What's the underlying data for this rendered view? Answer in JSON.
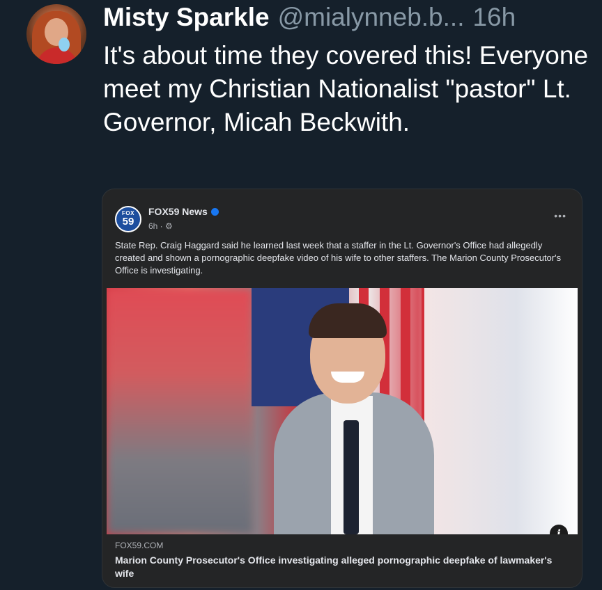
{
  "tweet": {
    "display_name": "Misty Sparkle",
    "handle": "@mialynneb.b...",
    "time": "16h",
    "text": "It's about time they covered this! Everyone meet my Christian Nationalist \"pastor\" Lt. Governor, Micah Beckwith."
  },
  "embed": {
    "page_name": "FOX59 News",
    "logo_top": "FOX",
    "logo_num": "59",
    "post_time": "6h · ⚙",
    "more": "•••",
    "post_text": "State Rep. Craig Haggard said he learned last week that a staffer in the Lt. Governor's Office had allegedly created and shown a pornographic deepfake video of his wife to other staffers. The Marion County Prosecutor's Office is investigating.",
    "link_domain": "FOX59.COM",
    "link_title": "Marion County Prosecutor's Office investigating alleged pornographic deepfake of lawmaker's wife",
    "info_icon": "i"
  },
  "colors": {
    "background": "#15202b",
    "card": "#242526",
    "secondary_text": "#8899a6",
    "verified": "#1877f2"
  }
}
